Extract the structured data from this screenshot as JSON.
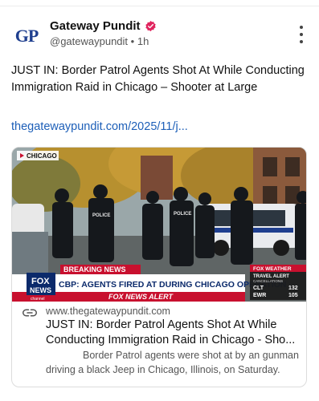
{
  "account": {
    "avatar_text": "GP",
    "display_name": "Gateway Pundit",
    "handle": "@gatewaypundit",
    "separator": "•",
    "time": "1h"
  },
  "post": {
    "text": "JUST IN: Border Patrol Agents Shot At While Conducting Immigration Raid in Chicago – Shooter at Large",
    "link": "thegatewaypundit.com/2025/11/j..."
  },
  "card": {
    "domain": "www.thegatewaypundit.com",
    "title_line1": "JUST IN: Border Patrol Agents Shot At While",
    "title_line2": "Conducting Immigration Raid in Chicago - Sho...",
    "desc_line1": "Border Patrol agents were shot at by an gunman",
    "desc_line2": "driving a black Jeep in Chicago, Illinois, on Saturday.",
    "image": {
      "location_tag": "CHICAGO",
      "police_text": "POLICE",
      "breaking_news": "BREAKING NEWS",
      "headline": "CBP: AGENTS FIRED AT DURING CHICAGO OPERATION",
      "alert": "FOX NEWS ALERT",
      "fox_logo_top": "FOX",
      "fox_logo_bottom": "NEWS",
      "fox_logo_channel": "channel",
      "weather_title": "FOX WEATHER",
      "weather_sub": "TRAVEL ALERT",
      "weather_sub2": "CANCELLATIONS",
      "weather_rows": [
        {
          "code": "CLT",
          "value": "132"
        },
        {
          "code": "EWR",
          "value": "105"
        }
      ]
    }
  },
  "colors": {
    "link": "#1d5fb8",
    "verified": "#e0245e",
    "breaking_red": "#c8102e",
    "fox_blue": "#0b2a6b"
  },
  "icons": [
    "verified-badge-icon",
    "more-options-icon",
    "link-icon"
  ]
}
